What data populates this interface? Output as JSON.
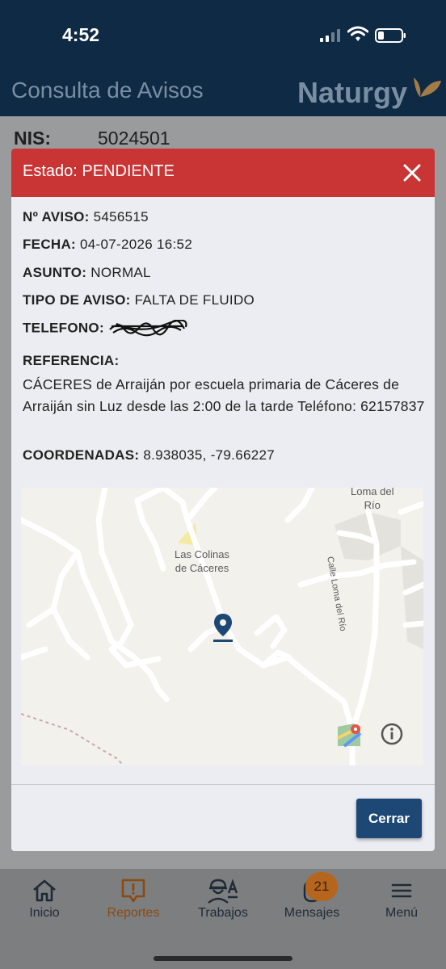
{
  "status_bar": {
    "time": "4:52"
  },
  "header": {
    "title": "Consulta de Avisos",
    "brand": "Naturgy"
  },
  "page": {
    "nis_label": "NIS:",
    "nis_value": "5024501"
  },
  "modal": {
    "title": "Estado: PENDIENTE",
    "fields": {
      "aviso_label": "Nº AVISO:",
      "aviso_value": "5456515",
      "fecha_label": "FECHA:",
      "fecha_value": "04-07-2026 16:52",
      "asunto_label": "ASUNTO:",
      "asunto_value": "NORMAL",
      "tipo_label": "TIPO DE AVISO:",
      "tipo_value": "FALTA DE FLUIDO",
      "telefono_label": "TELEFONO:",
      "referencia_label": "REFERENCIA:",
      "referencia_value": "CÁCERES de Arraiján por escuela primaria de Cáceres de Arraiján sin Luz desde las 2:00 de la tarde Teléfono: 62157837",
      "coordenadas_label": "COORDENADAS:",
      "coordenadas_value": "8.938035, -79.66227"
    },
    "map": {
      "place_label": "Las Colinas de Cáceres",
      "place_line1": "Las Colinas",
      "place_line2": "de Cáceres",
      "street_label": "Calle Loma del Río",
      "corner_label_1": "Loma del",
      "corner_label_2": "Río"
    },
    "close_button": "Cerrar"
  },
  "bottom_nav": {
    "items": [
      {
        "label": "Inicio",
        "icon": "home-icon"
      },
      {
        "label": "Reportes",
        "icon": "report-icon"
      },
      {
        "label": "Trabajos",
        "icon": "worker-icon"
      },
      {
        "label": "Mensajes",
        "icon": "messages-icon"
      },
      {
        "label": "Menú",
        "icon": "menu-icon"
      }
    ],
    "messages_badge": "21"
  },
  "colors": {
    "header_bg": "#0f2a44",
    "modal_header": "#c93535",
    "primary_button": "#1d4875",
    "active_nav": "#b5651d",
    "map_pin": "#1d4875"
  }
}
